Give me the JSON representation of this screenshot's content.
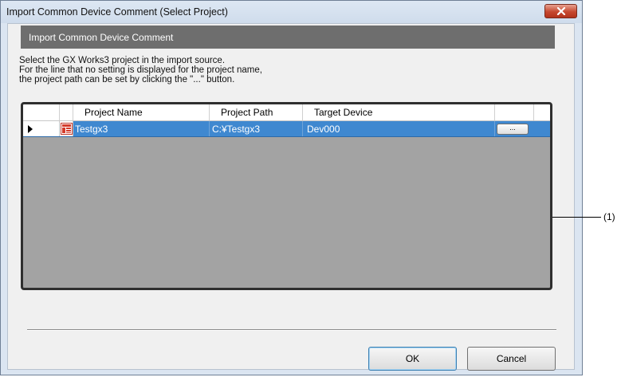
{
  "window": {
    "title": "Import Common Device Comment (Select Project)"
  },
  "section": {
    "header": "Import Common Device Comment"
  },
  "instructions": [
    "Select the GX Works3 project in the import source.",
    "For the line that no setting is displayed for the project name,",
    "the project path can be set by clicking the \"...\" button."
  ],
  "grid": {
    "columns": [
      "Project Name",
      "Project Path",
      "Target Device"
    ],
    "rows": [
      {
        "project_name": "Testgx3",
        "project_path": "C:¥Testgx3",
        "target_device": "Dev000",
        "browse_label": "...",
        "icon": "gx-works3-project-icon",
        "selected": true
      }
    ]
  },
  "buttons": {
    "ok": "OK",
    "cancel": "Cancel"
  },
  "callout": {
    "label": "(1)"
  },
  "colors": {
    "selection": "#3f88d0",
    "section_header": "#6e6e6e",
    "grid_background": "#a3a3a3",
    "close_button": "#c6482f"
  }
}
